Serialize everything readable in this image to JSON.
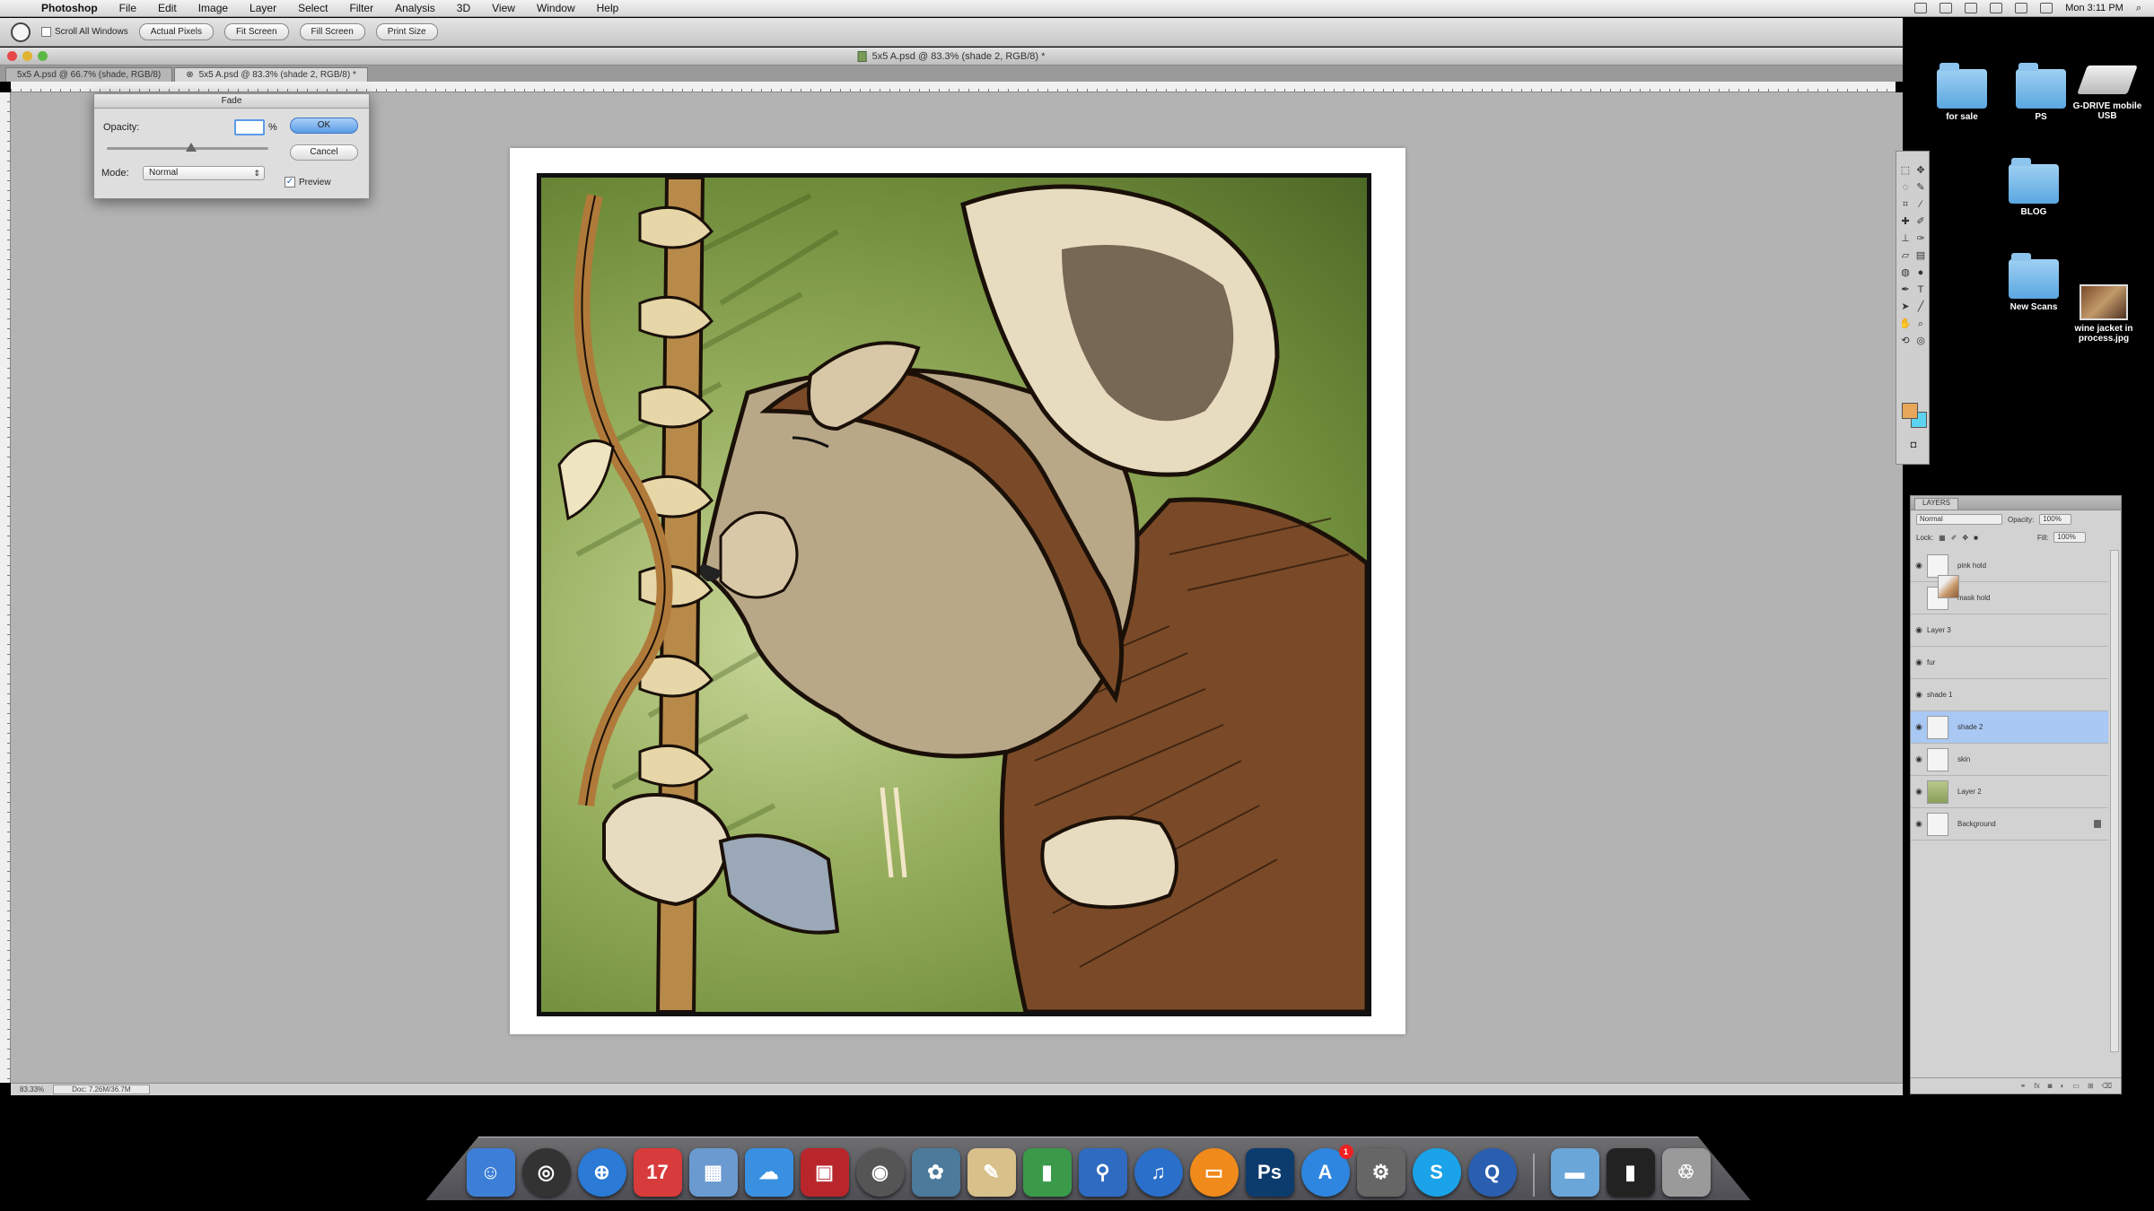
{
  "menubar": {
    "items": [
      "Photoshop",
      "File",
      "Edit",
      "Image",
      "Layer",
      "Select",
      "Filter",
      "Analysis",
      "3D",
      "View",
      "Window",
      "Help"
    ],
    "clock": "Mon 3:11 PM"
  },
  "options_bar": {
    "scroll_all_label": "Scroll All Windows",
    "buttons": [
      "Actual Pixels",
      "Fit Screen",
      "Fill Screen",
      "Print Size"
    ]
  },
  "window": {
    "title": "5x5 A.psd @ 83.3% (shade 2, RGB/8) *"
  },
  "tabs": [
    {
      "label": "5x5 A.psd @ 66.7% (shade, RGB/8)"
    },
    {
      "label": "5x5 A.psd @ 83.3% (shade 2, RGB/8) *"
    }
  ],
  "status_bar": {
    "zoom": "83.33%",
    "doc_info": "Doc: 7.26M/36.7M"
  },
  "fade_dialog": {
    "title": "Fade",
    "opacity_label": "Opacity:",
    "opacity_unit": "%",
    "mode_label": "Mode:",
    "mode_value": "Normal",
    "ok_label": "OK",
    "cancel_label": "Cancel",
    "preview_label": "Preview",
    "preview_checked": true
  },
  "desktop_icons": [
    {
      "label": "for sale",
      "kind": "folder"
    },
    {
      "label": "PS",
      "kind": "folder"
    },
    {
      "label": "G-DRIVE mobile USB",
      "kind": "drive"
    },
    {
      "label": "BLOG",
      "kind": "folder"
    },
    {
      "label": "New Scans",
      "kind": "folder"
    },
    {
      "label": "wine jacket in process.jpg",
      "kind": "image"
    }
  ],
  "tools_panel": {
    "tools": [
      "marquee",
      "move",
      "lasso",
      "quick-select",
      "crop",
      "eyedropper",
      "healing",
      "brush",
      "stamp",
      "history-brush",
      "eraser",
      "gradient",
      "blur",
      "dodge",
      "pen",
      "type",
      "path-select",
      "shape",
      "hand",
      "zoom",
      "3d-rotate",
      "3d-orbit"
    ],
    "foreground_color": "#e8a65a",
    "background_color": "#5ed3f0"
  },
  "layers_panel": {
    "tab_label": "LAYERS",
    "blend_mode": "Normal",
    "opacity_label": "Opacity:",
    "opacity_value": "100%",
    "lock_label": "Lock:",
    "fill_label": "Fill:",
    "fill_value": "100%",
    "layers": [
      {
        "name": "pink hold",
        "visible": true,
        "selected": false,
        "thumb": "white"
      },
      {
        "name": "mask hold",
        "visible": false,
        "selected": false,
        "thumb": "white"
      },
      {
        "name": "Layer 3",
        "visible": true,
        "selected": false,
        "thumb": "art"
      },
      {
        "name": "fur",
        "visible": true,
        "selected": false,
        "thumb": "art"
      },
      {
        "name": "shade 1",
        "visible": true,
        "selected": false,
        "thumb": "art"
      },
      {
        "name": "shade 2",
        "visible": true,
        "selected": true,
        "thumb": "white"
      },
      {
        "name": "skin",
        "visible": true,
        "selected": false,
        "thumb": "white"
      },
      {
        "name": "Layer 2",
        "visible": true,
        "selected": false,
        "thumb": "green"
      },
      {
        "name": "Background",
        "visible": true,
        "selected": false,
        "thumb": "white",
        "locked": true
      }
    ]
  },
  "dock": {
    "apps": [
      {
        "name": "Finder",
        "glyph": "☺",
        "color": "#3d7fd6"
      },
      {
        "name": "Dashboard",
        "glyph": "◎",
        "color": "#333"
      },
      {
        "name": "Safari",
        "glyph": "⊕",
        "color": "#2a7ad6"
      },
      {
        "name": "iCal",
        "glyph": "17",
        "color": "#d83b3b"
      },
      {
        "name": "Preview",
        "glyph": "▦",
        "color": "#6a9ad0"
      },
      {
        "name": "iChat",
        "glyph": "☁",
        "color": "#3a90e0"
      },
      {
        "name": "Photo Booth",
        "glyph": "▣",
        "color": "#b8262b"
      },
      {
        "name": "FaceTime",
        "glyph": "◉",
        "color": "#555"
      },
      {
        "name": "iPhoto",
        "glyph": "✿",
        "color": "#4b7a9a"
      },
      {
        "name": "TextEdit",
        "glyph": "✎",
        "color": "#d8c08a"
      },
      {
        "name": "Numbers",
        "glyph": "▮",
        "color": "#3a9a4a"
      },
      {
        "name": "Keynote",
        "glyph": "⚲",
        "color": "#2f6bc0"
      },
      {
        "name": "iTunes",
        "glyph": "♫",
        "color": "#2a6fc9"
      },
      {
        "name": "iBooks",
        "glyph": "▭",
        "color": "#f08a1a"
      },
      {
        "name": "Photoshop",
        "glyph": "Ps",
        "color": "#0c3b6e"
      },
      {
        "name": "App Store",
        "glyph": "A",
        "color": "#2e86e0",
        "badge": "1"
      },
      {
        "name": "System Preferences",
        "glyph": "⚙",
        "color": "#666"
      },
      {
        "name": "Skype",
        "glyph": "S",
        "color": "#1aa3e8"
      },
      {
        "name": "QuickTime",
        "glyph": "Q",
        "color": "#2a5fb0"
      }
    ],
    "right_items": [
      {
        "name": "Applications folder",
        "glyph": "▬",
        "color": "#6aa6d8"
      },
      {
        "name": "Downloads stack",
        "glyph": "▮",
        "color": "#222"
      },
      {
        "name": "Trash",
        "glyph": "♲",
        "color": "#9a9a9a"
      }
    ]
  }
}
